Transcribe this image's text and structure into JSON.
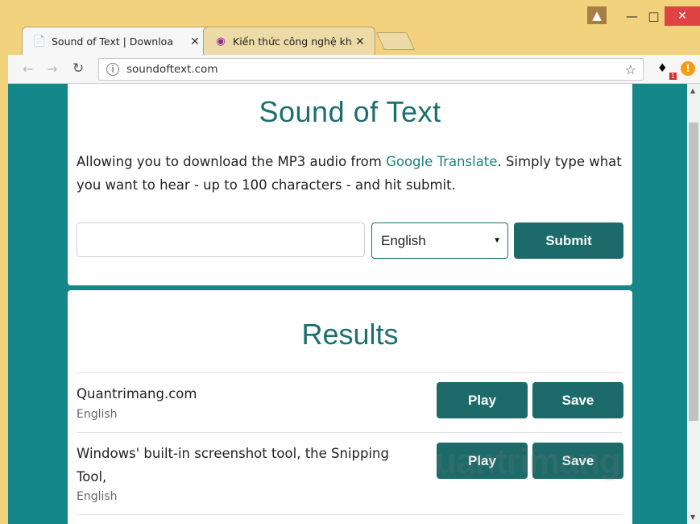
{
  "browser": {
    "tabs": [
      {
        "title": "Sound of Text | Downloa",
        "close": "✕"
      },
      {
        "title": "Kiến thức công nghệ kho",
        "close": "✕"
      }
    ],
    "url": "soundoftext.com",
    "ext_badge": "1",
    "ext_alert": "!"
  },
  "page": {
    "title": "Sound of Text",
    "desc_before": "Allowing you to download the MP3 audio from ",
    "desc_link": "Google Translate",
    "desc_after": ". Simply type what you want to hear - up to 100 characters - and hit submit.",
    "text_input_value": "",
    "language_selected": "English",
    "submit_label": "Submit",
    "results_title": "Results",
    "results": [
      {
        "text": "Quantrimang.com",
        "lang": "English",
        "play": "Play",
        "save": "Save"
      },
      {
        "text": "Windows' built-in screenshot tool, the Snipping Tool,",
        "lang": "English",
        "play": "Play",
        "save": "Save"
      }
    ]
  },
  "watermark": "uantrimang",
  "colors": {
    "teal_bg": "#15878a",
    "accent": "#1c6a6a",
    "heading": "#1c6f6f",
    "chrome": "#f2d27c"
  }
}
